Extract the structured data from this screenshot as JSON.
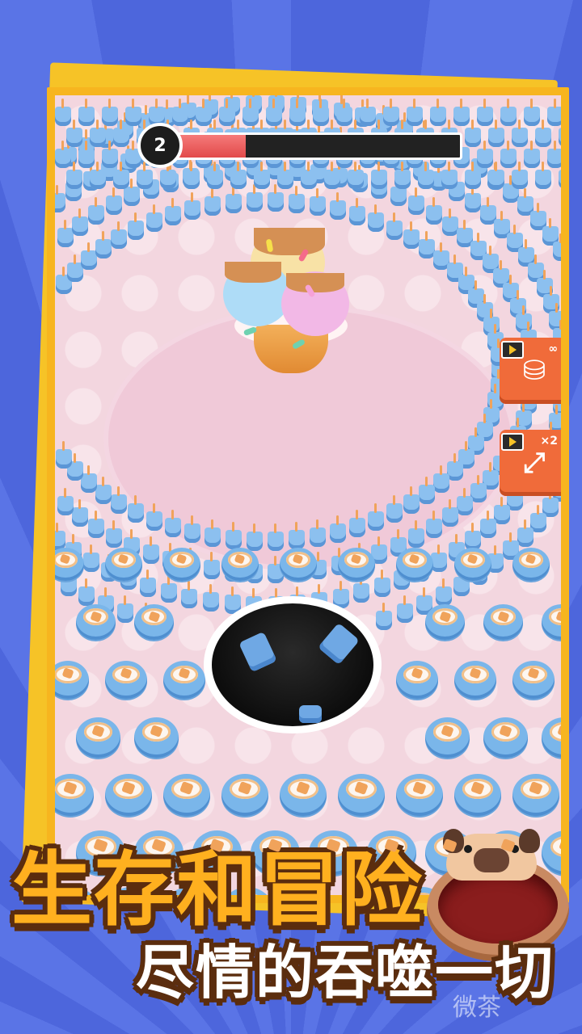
{
  "hud": {
    "level": "2",
    "progress": 0.25
  },
  "powerups": [
    {
      "name": "size-boost",
      "icon": "cup-stack-icon",
      "tag": "∞",
      "ad": "video-icon"
    },
    {
      "name": "range-boost",
      "icon": "expand-arrows-icon",
      "tag": "×2",
      "ad": "video-icon"
    }
  ],
  "headline": {
    "line1": "生存和冒险",
    "line2": "尽情的吞噬一切"
  },
  "watermark": "微茶",
  "colors": {
    "background": "#4a63d9",
    "card": "#f7b51f",
    "floor": "#f3d6df",
    "cup": "#7ab6ea",
    "progress_fill": "#e24a4a",
    "powerup": "#f06b3a",
    "headline_line1": "#ffb01f",
    "headline_line2": "#ffffff",
    "outline": "#5b2d0e"
  }
}
